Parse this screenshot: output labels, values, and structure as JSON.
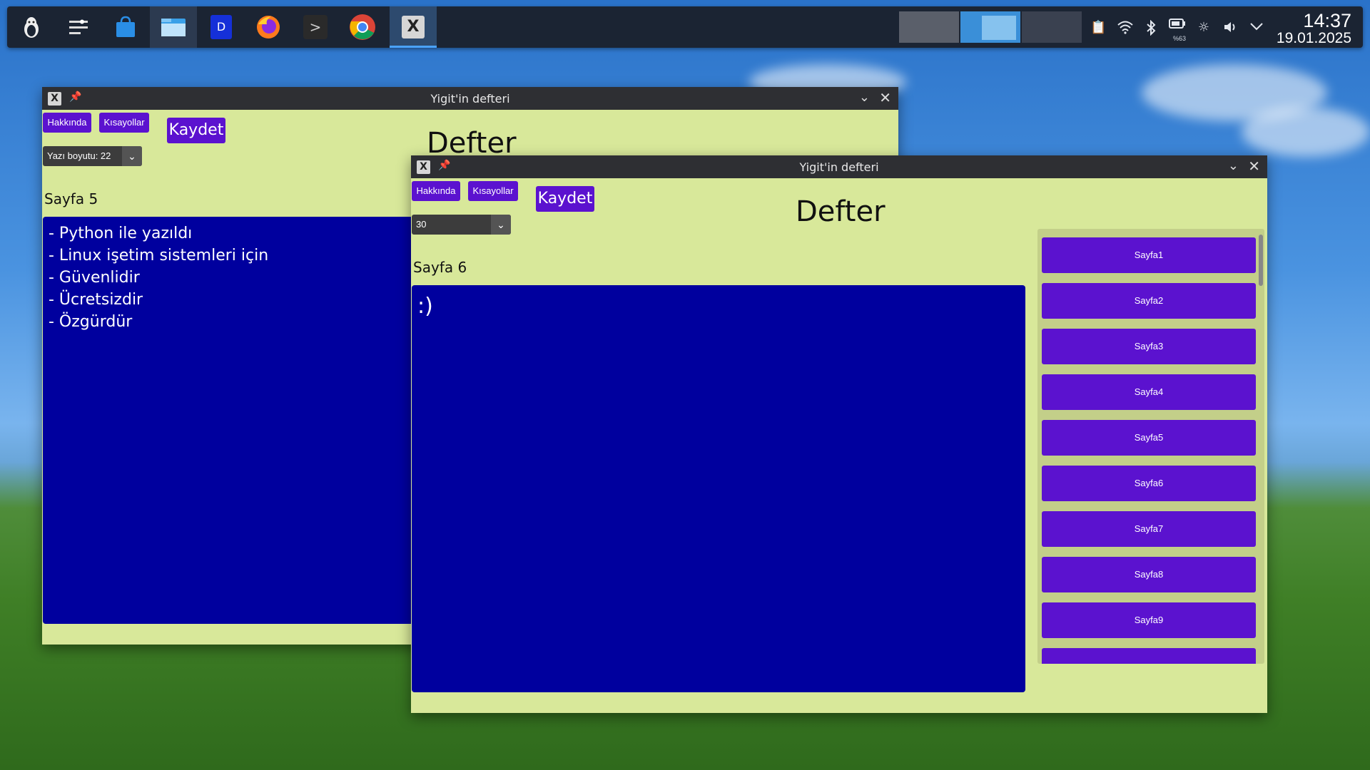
{
  "taskbar": {
    "icons": [
      "linux-tux-icon",
      "settings-sliders-icon",
      "store-bag-icon",
      "file-manager-icon",
      "d-app-icon",
      "firefox-icon",
      "terminal-icon",
      "chrome-icon",
      "defter-app-icon"
    ],
    "d_label": "D",
    "terminal_glyph": ">",
    "battery": "%63",
    "time": "14:37",
    "date": "19.01.2025"
  },
  "back_window": {
    "title": "Yigit'in defteri",
    "about_label": "Hakkında",
    "shortcuts_label": "Kısayollar",
    "save_label": "Kaydet",
    "font_size_value": "Yazı boyutu: 22",
    "heading": "Defter",
    "page_label": "Sayfa 5",
    "lines": [
      "- Python ile yazıldı",
      "- Linux işetim sistemleri için",
      "- Güvenlidir",
      "- Ücretsizdir",
      "- Özgürdür"
    ]
  },
  "front_window": {
    "title": "Yigit'in defteri",
    "about_label": "Hakkında",
    "shortcuts_label": "Kısayollar",
    "save_label": "Kaydet",
    "font_size_value": "30",
    "heading": "Defter",
    "page_label": "Sayfa 6",
    "content": ":)",
    "pages": [
      "Sayfa1",
      "Sayfa2",
      "Sayfa3",
      "Sayfa4",
      "Sayfa5",
      "Sayfa6",
      "Sayfa7",
      "Sayfa8",
      "Sayfa9",
      ""
    ]
  },
  "colors": {
    "accent": "#5b12cf",
    "editor_bg": "#00009e",
    "window_bg": "#d8e89a"
  }
}
